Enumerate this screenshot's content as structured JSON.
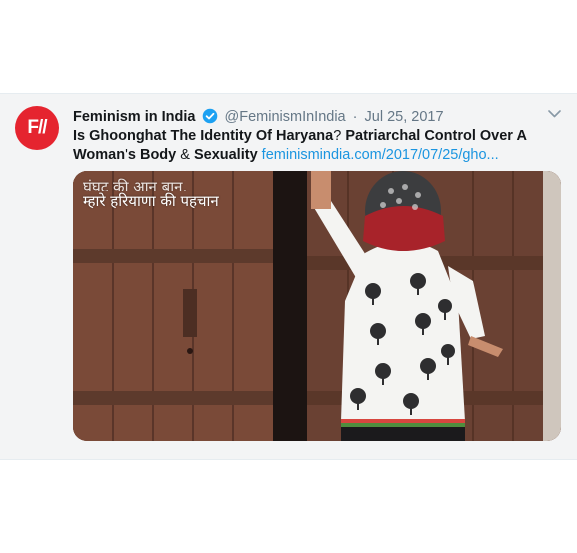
{
  "tweet": {
    "avatar_text": "F//",
    "display_name": "Feminism in India",
    "handle": "@FeminismInIndia",
    "separator": "·",
    "date": "Jul 25, 2017",
    "text_part1": "Is Ghoonghat The Identity Of Haryana",
    "text_q": "?",
    "text_part2": " Patriarchal Control Over A Woman",
    "text_apos": "'",
    "text_part3": "s Body ",
    "text_amp": "&",
    "text_part4": " Sexuality ",
    "link": "feminismindia.com/2017/07/25/gho...",
    "image_overlay_line1": "घूंघट की आन बान,",
    "image_overlay_line2": "म्हारे हरियाणा की पहचान"
  },
  "colors": {
    "avatar_bg": "#e5242f",
    "link": "#1b95e0",
    "verified": "#1da1f2",
    "card_bg": "#f3f4f5"
  },
  "icons": {
    "verified": "verified-badge-icon",
    "menu": "chevron-down-icon"
  }
}
